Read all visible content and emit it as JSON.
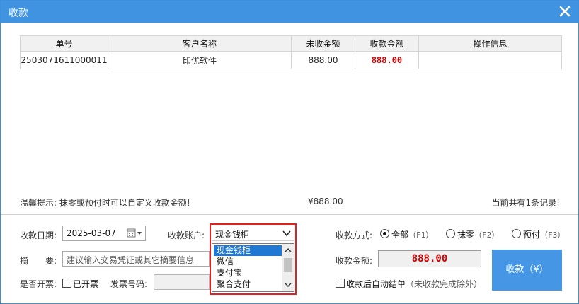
{
  "window": {
    "title": "收款",
    "close_icon": "close-icon"
  },
  "table": {
    "headers": [
      "单号",
      "客户名称",
      "未收金额",
      "收款金额",
      "操作信息"
    ],
    "rows": [
      {
        "order_no": "2503071611000011",
        "customer": "印优软件",
        "unpaid": "888.00",
        "receipt": "888.00",
        "info": ""
      }
    ]
  },
  "footer": {
    "hint": "温馨提示: 抹零或预付时可以自定义收款金额!",
    "total": "¥888.00",
    "count": "当前共有1条记录!"
  },
  "form": {
    "date_label": "收款日期:",
    "date_value": "2025-03-07",
    "account_label": "收款账户:",
    "account_value": "现金钱柜",
    "account_options": [
      "现金钱柜",
      "微信",
      "支付宝",
      "聚合支付"
    ],
    "memo_label": "摘　　要:",
    "memo_placeholder": "建议输入交易凭证或其它摘要信息",
    "invoice_label": "是否开票:",
    "invoice_checkbox": "已开票",
    "invoice_no_label": "发票号码:",
    "method_label": "收款方式:",
    "methods": [
      {
        "label": "全部",
        "key": "（F1）",
        "selected": true
      },
      {
        "label": "抹零",
        "key": "（F2）",
        "selected": false
      },
      {
        "label": "预付",
        "key": "（F3）",
        "selected": false
      }
    ],
    "amount_label": "收款金额:",
    "amount_value": "888.00",
    "auto_settle_label": "收款后自动结单",
    "auto_settle_note": "（未收款完成除外）",
    "pay_button": "收款（¥）"
  },
  "colors": {
    "title_bar": "#3f93e0",
    "accent_red": "#d40000",
    "frame_red": "#e32020",
    "button_blue": "#4596e4"
  }
}
